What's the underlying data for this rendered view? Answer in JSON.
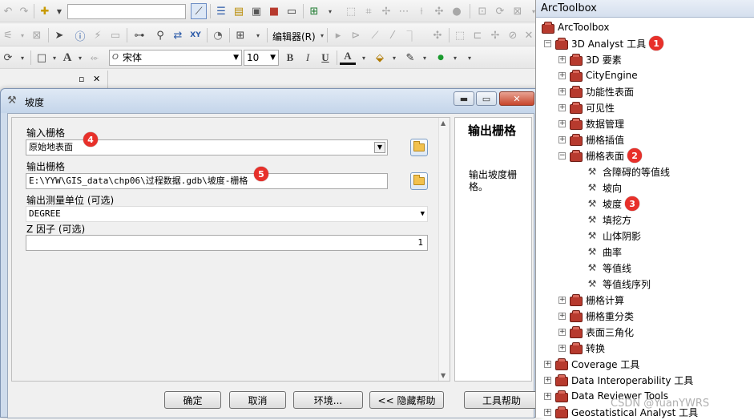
{
  "toolbars": {
    "row1_icons": [
      "back-icon",
      "forward-icon",
      "add-data-icon",
      "scale-combo",
      "editor-toolbar-icon",
      "table-icon",
      "layout-icon",
      "arctoolbox-icon",
      "python-icon",
      "model-icon"
    ],
    "row2": {
      "editor_menu": "编辑器(R)"
    },
    "row3": {
      "font_name": "宋体",
      "font_size": "10",
      "bold": "B",
      "italic": "I",
      "underline": "U",
      "font_color_letter": "A"
    }
  },
  "dialog": {
    "title": "坡度",
    "params": [
      {
        "label": "输入栅格",
        "value": "原始地表面",
        "marker": "4"
      },
      {
        "label": "输出栅格",
        "value": "E:\\YYW\\GIS_data\\chp06\\过程数据.gdb\\坡度-栅格",
        "marker": "5"
      },
      {
        "label": "输出测量单位 (可选)",
        "value": "DEGREE"
      },
      {
        "label": "Z 因子 (可选)",
        "value": "1"
      }
    ],
    "help": {
      "title": "输出栅格",
      "description": "输出坡度栅格。"
    },
    "buttons": {
      "ok": "确定",
      "cancel": "取消",
      "environments": "环境...",
      "hide_help": "<< 隐藏帮助",
      "tool_help": "工具帮助"
    }
  },
  "toolbox": {
    "header": "ArcToolbox",
    "root": "ArcToolbox",
    "items": [
      {
        "label": "3D Analyst 工具",
        "level": 1,
        "expander": "−",
        "icon": "toolbox",
        "marker": "1"
      },
      {
        "label": "3D 要素",
        "level": 2,
        "expander": "+",
        "icon": "toolset"
      },
      {
        "label": "CityEngine",
        "level": 2,
        "expander": "+",
        "icon": "toolset"
      },
      {
        "label": "功能性表面",
        "level": 2,
        "expander": "+",
        "icon": "toolset"
      },
      {
        "label": "可见性",
        "level": 2,
        "expander": "+",
        "icon": "toolset"
      },
      {
        "label": "数据管理",
        "level": 2,
        "expander": "+",
        "icon": "toolset"
      },
      {
        "label": "栅格插值",
        "level": 2,
        "expander": "+",
        "icon": "toolset"
      },
      {
        "label": "栅格表面",
        "level": 2,
        "expander": "−",
        "icon": "toolset",
        "marker": "2"
      },
      {
        "label": "含障碍的等值线",
        "level": 3,
        "expander": "",
        "icon": "tool"
      },
      {
        "label": "坡向",
        "level": 3,
        "expander": "",
        "icon": "tool"
      },
      {
        "label": "坡度",
        "level": 3,
        "expander": "",
        "icon": "tool",
        "marker": "3"
      },
      {
        "label": "填挖方",
        "level": 3,
        "expander": "",
        "icon": "tool"
      },
      {
        "label": "山体阴影",
        "level": 3,
        "expander": "",
        "icon": "tool"
      },
      {
        "label": "曲率",
        "level": 3,
        "expander": "",
        "icon": "tool"
      },
      {
        "label": "等值线",
        "level": 3,
        "expander": "",
        "icon": "tool"
      },
      {
        "label": "等值线序列",
        "level": 3,
        "expander": "",
        "icon": "tool"
      },
      {
        "label": "栅格计算",
        "level": 2,
        "expander": "+",
        "icon": "toolset"
      },
      {
        "label": "栅格重分类",
        "level": 2,
        "expander": "+",
        "icon": "toolset"
      },
      {
        "label": "表面三角化",
        "level": 2,
        "expander": "+",
        "icon": "toolset"
      },
      {
        "label": "转换",
        "level": 2,
        "expander": "+",
        "icon": "toolset"
      },
      {
        "label": "Coverage 工具",
        "level": 1,
        "expander": "+",
        "icon": "toolbox"
      },
      {
        "label": "Data Interoperability 工具",
        "level": 1,
        "expander": "+",
        "icon": "toolbox"
      },
      {
        "label": "Data Reviewer Tools",
        "level": 1,
        "expander": "+",
        "icon": "toolbox"
      },
      {
        "label": "Geostatistical Analyst 工具",
        "level": 1,
        "expander": "+",
        "icon": "toolbox"
      }
    ]
  },
  "watermark": "CSDN @YuanYWRS",
  "colors": {
    "marker": "#e8302a",
    "toolbox_red": "#b73a2e"
  }
}
